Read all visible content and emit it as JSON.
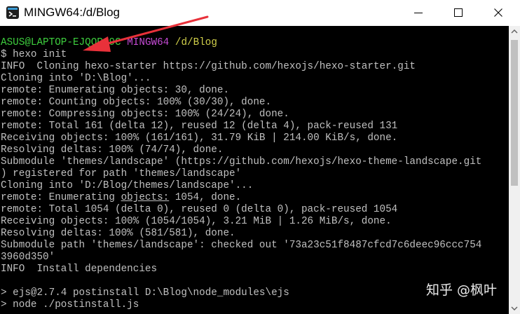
{
  "window": {
    "title": "MINGW64:/d/Blog",
    "controls": {
      "minimize": "minimize-icon",
      "maximize": "maximize-icon",
      "close": "close-icon"
    }
  },
  "prompt": {
    "user_host": "ASUS@LAPTOP-EJQOR",
    "host_obscured": "J9C",
    "shell": "MINGW64",
    "path": "/d/Blog",
    "command": "$ hexo init"
  },
  "output": {
    "l1": "INFO  Cloning hexo-starter https://github.com/hexojs/hexo-starter.git",
    "l2": "Cloning into 'D:\\Blog'...",
    "l3": "remote: Enumerating objects: 30, done.",
    "l4": "remote: Counting objects: 100% (30/30), done.",
    "l5": "remote: Compressing objects: 100% (24/24), done.",
    "l6": "remote: Total 161 (delta 12), reused 12 (delta 4), pack-reused 131",
    "l7": "Receiving objects: 100% (161/161), 31.79 KiB | 214.00 KiB/s, done.",
    "l8": "Resolving deltas: 100% (74/74), done.",
    "l9": "Submodule 'themes/landscape' (https://github.com/hexojs/hexo-theme-landscape.git",
    "l10": ") registered for path 'themes/landscape'",
    "l11": "Cloning into 'D:/Blog/themes/landscape'...",
    "l12_pre": "remote: Enumerating ",
    "l12_u": "objects:",
    "l12_post": " 1054, done.",
    "l13": "remote: Total 1054 (delta 0), reused 0 (delta 0), pack-reused 1054",
    "l14": "Receiving objects: 100% (1054/1054), 3.21 MiB | 1.26 MiB/s, done.",
    "l15": "Resolving deltas: 100% (581/581), done.",
    "l16": "Submodule path 'themes/landscape': checked out '73a23c51f8487cfcd7c6deec96ccc754",
    "l17": "3960d350'",
    "l18": "INFO  Install dependencies",
    "l19": "",
    "l20": "> ejs@2.7.4 postinstall D:\\Blog\\node_modules\\ejs",
    "l21": "> node ./postinstall.js"
  },
  "watermark": "知乎 @枫叶",
  "colors": {
    "terminal_bg": "#000000",
    "terminal_text": "#c0c0c0",
    "prompt_green": "#3ecf3e",
    "prompt_magenta": "#c64bd6",
    "prompt_yellow": "#d0cf4a",
    "annotation_arrow": "#e8313a"
  }
}
